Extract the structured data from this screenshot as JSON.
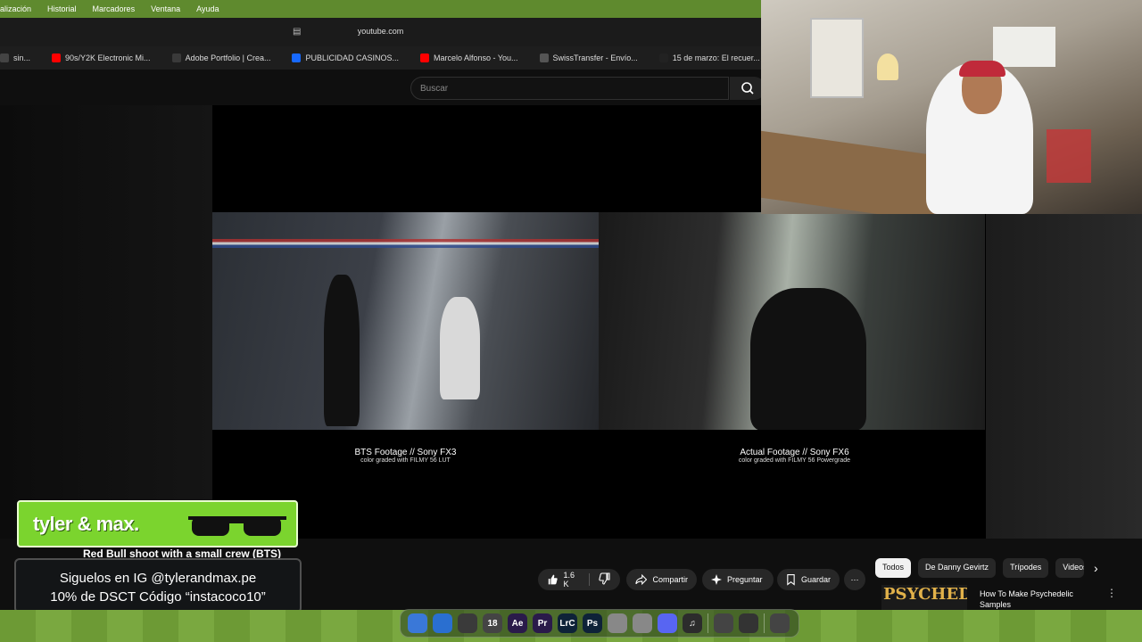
{
  "menubar": {
    "items": [
      "alización",
      "Historial",
      "Marcadores",
      "Ventana",
      "Ayuda"
    ]
  },
  "browser": {
    "url": "youtube.com",
    "bookmarks": [
      {
        "label": "sin...",
        "icon": "folder-icon",
        "color": "#444444"
      },
      {
        "label": "90s/Y2K Electronic Mi...",
        "icon": "youtube-icon",
        "color": "#ff0000"
      },
      {
        "label": "Adobe Portfolio | Crea...",
        "icon": "adobe-portfolio-icon",
        "color": "#3a3a3a"
      },
      {
        "label": "PUBLICIDAD CASINOS...",
        "icon": "behance-icon",
        "color": "#1769ff"
      },
      {
        "label": "Marcelo Alfonso - You...",
        "icon": "youtube-icon",
        "color": "#ff0000"
      },
      {
        "label": "SwissTransfer - Envío...",
        "icon": "swisstransfer-icon",
        "color": "#555555"
      },
      {
        "label": "15 de marzo: El recuer...",
        "icon": "tiktok-icon",
        "color": "#222222"
      }
    ]
  },
  "youtube": {
    "search_placeholder": "Buscar",
    "video_title": "Red Bull shoot with a small crew (BTS)",
    "captions": [
      {
        "title": "BTS Footage // Sony FX3",
        "sub": "color graded with FILMY 56 LUT"
      },
      {
        "title": "Actual Footage // Sony FX6",
        "sub": "color graded with FILMY 56 Powergrade"
      }
    ],
    "actions": {
      "likes": "1.6 K",
      "share": "Compartir",
      "ask": "Preguntar",
      "save": "Guardar",
      "more": "⋯"
    },
    "chips": [
      "Todos",
      "De Danny Gevirtz",
      "Trípodes",
      "Videos"
    ],
    "recommendation": {
      "thumb_text": "PSYCHEDELIC",
      "title": "How To Make Psychedelic Samples"
    }
  },
  "overlay": {
    "brand": "tyler & max.",
    "line1": "Siguelos en IG @tylerandmax.pe",
    "line2": "10% de DSCT Código “instacoco10”"
  },
  "dock": {
    "apps": [
      {
        "label": "",
        "icon": "finder-icon",
        "color": "#3a78d8"
      },
      {
        "label": "",
        "icon": "safari-icon",
        "color": "#2a6fd0"
      },
      {
        "label": "",
        "icon": "notes-icon",
        "color": "#3a3a3a"
      },
      {
        "label": "18",
        "icon": "calendar-icon",
        "color": "#444444"
      },
      {
        "label": "Ae",
        "icon": "after-effects-icon",
        "color": "#2a1a4a"
      },
      {
        "label": "Pr",
        "icon": "premiere-icon",
        "color": "#2a1a4a"
      },
      {
        "label": "LrC",
        "icon": "lightroom-icon",
        "color": "#0e2238"
      },
      {
        "label": "Ps",
        "icon": "photoshop-icon",
        "color": "#0e2238"
      },
      {
        "label": "",
        "icon": "app-icon",
        "color": "#888888"
      },
      {
        "label": "",
        "icon": "keynote-icon",
        "color": "#888888"
      },
      {
        "label": "",
        "icon": "discord-icon",
        "color": "#5865f2"
      },
      {
        "label": "♫",
        "icon": "music-icon",
        "color": "#2c2c2c"
      },
      {
        "label": "",
        "icon": "screen-recorder-icon",
        "color": "#444444"
      },
      {
        "label": "",
        "icon": "obs-icon",
        "color": "#333333"
      },
      {
        "label": "",
        "icon": "trash-icon",
        "color": "#444444"
      }
    ]
  }
}
